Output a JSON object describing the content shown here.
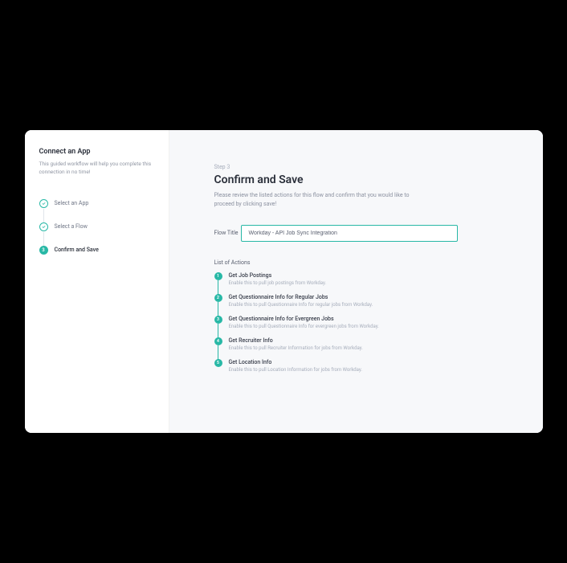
{
  "sidebar": {
    "title": "Connect an App",
    "description": "This guided workflow will help you complete this connection in no time!",
    "steps": [
      {
        "label": "Select an App",
        "state": "done"
      },
      {
        "label": "Select a Flow",
        "state": "done"
      },
      {
        "label": "Confirm and Save",
        "state": "current",
        "num": "3"
      }
    ]
  },
  "main": {
    "step_tag": "Step 3",
    "heading": "Confirm and Save",
    "description": "Please review the listed actions for this flow and confirm that you would like to proceed by clicking save!",
    "flow_title_label": "Flow Title",
    "flow_title_value": "Workday - API Job Sync Integration",
    "actions_label": "List of Actions",
    "actions": [
      {
        "n": "1",
        "title": "Get Job Postings",
        "desc": "Enable this to pull job postings from Workday."
      },
      {
        "n": "2",
        "title": "Get Questionnaire Info for Regular Jobs",
        "desc": "Enable this to pull Questionnaire Info for regular jobs from Workday."
      },
      {
        "n": "3",
        "title": "Get Questionnaire Info for Evergreen Jobs",
        "desc": "Enable this to pull Questionnaire Info for evergreen jobs from Workday."
      },
      {
        "n": "4",
        "title": "Get Recruiter Info",
        "desc": "Enable this to pull Recruiter Information for jobs from Workday."
      },
      {
        "n": "5",
        "title": "Get Location Info",
        "desc": "Enable this to pull Location Information for jobs from Workday."
      }
    ]
  }
}
